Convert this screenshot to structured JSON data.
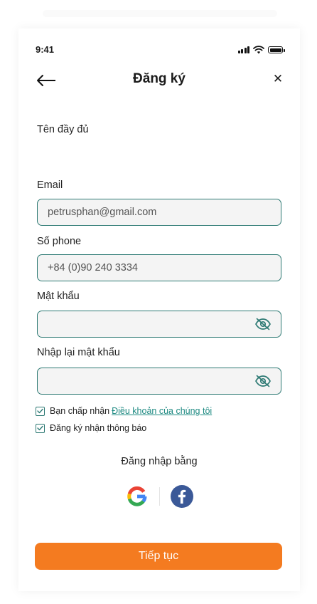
{
  "status_bar": {
    "time": "9:41"
  },
  "header": {
    "title": "Đăng ký",
    "close_symbol": "✕"
  },
  "form": {
    "full_name": {
      "label": "Tên đầy đủ"
    },
    "email": {
      "label": "Email",
      "value": "petrusphan@gmail.com"
    },
    "phone": {
      "label": "Số phone",
      "value": "+84 (0)90 240 3334"
    },
    "password": {
      "label": "Mật khẩu",
      "value": ""
    },
    "confirm_password": {
      "label": "Nhập lại mật khẩu",
      "value": ""
    }
  },
  "agreements": {
    "terms_prefix": "Bạn chấp nhận",
    "terms_link": "Điều khoản của chúng tôi",
    "terms_checked": true,
    "notifications_label": "Đăng ký nhận thông báo",
    "notifications_checked": true
  },
  "social": {
    "title": "Đăng nhập bằng",
    "providers": [
      "google-icon",
      "facebook-icon"
    ]
  },
  "continue_label": "Tiếp tục",
  "colors": {
    "accent": "#f47b20",
    "field_border": "#2e7a74",
    "link": "#1e8a82",
    "facebook": "#3b5998"
  }
}
